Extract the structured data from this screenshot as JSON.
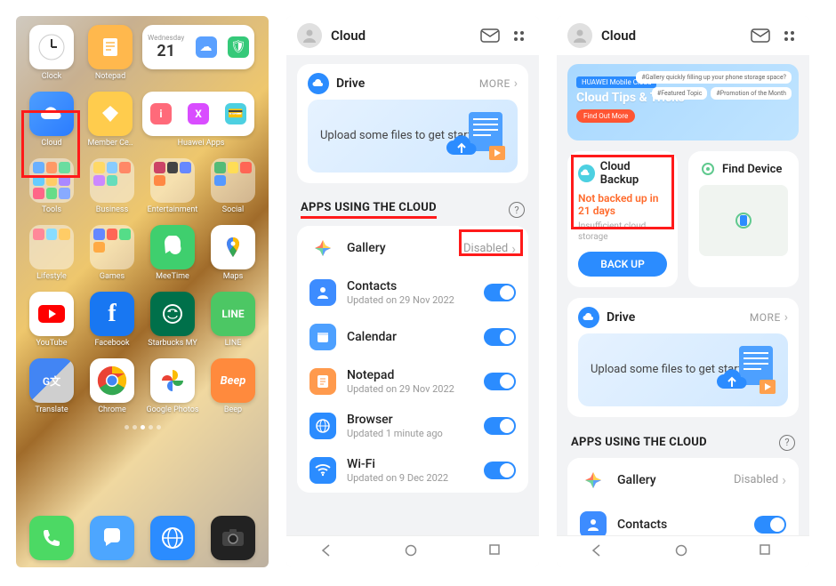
{
  "home": {
    "row1": {
      "clock": "Clock",
      "notepad": "Notepad",
      "cal_day": "21",
      "cal_dow": "Wednesday"
    },
    "row2": {
      "cloud": "Cloud",
      "member": "Member Ce..",
      "huawei_apps": "Huawei Apps"
    },
    "row3": {
      "tools": "Tools",
      "business": "Business",
      "entertainment": "Entertainment",
      "social": "Social"
    },
    "row4": {
      "lifestyle": "Lifestyle",
      "games": "Games",
      "meetime": "MeeTime",
      "maps": "Maps"
    },
    "row5": {
      "youtube": "YouTube",
      "facebook": "Facebook",
      "starbucks": "Starbucks MY",
      "line": "LINE"
    },
    "row6": {
      "translate": "Translate",
      "chrome": "Chrome",
      "gphotos": "Google Photos",
      "beep": "Beep"
    }
  },
  "cloud2": {
    "title": "Cloud",
    "drive": {
      "label": "Drive",
      "more": "MORE",
      "banner": "Upload some files to get started"
    },
    "section": "APPS USING THE CLOUD",
    "rows": {
      "gallery": {
        "title": "Gallery",
        "trail": "Disabled"
      },
      "contacts": {
        "title": "Contacts",
        "sub": "Updated on 29 Nov 2022"
      },
      "calendar": {
        "title": "Calendar"
      },
      "notepad": {
        "title": "Notepad",
        "sub": "Updated on 29 Nov 2022"
      },
      "browser": {
        "title": "Browser",
        "sub": "Updated 1 minute ago"
      },
      "wifi": {
        "title": "Wi-Fi",
        "sub": "Updated on 9 Dec 2022"
      }
    }
  },
  "cloud3": {
    "title": "Cloud",
    "promo": {
      "tag": "HUAWEI Mobile Cloud",
      "title": "Cloud Tips & Tricks",
      "pill1": "#Gallery quickly filling up your phone storage space?",
      "pill2": "#Featured Topic",
      "pill3": "#Promotion of the Month",
      "btn": "Find Out More"
    },
    "backup": {
      "title": "Cloud Backup",
      "warn": "Not backed up in 21 days",
      "sub": "Insufficient cloud storage",
      "btn": "BACK UP"
    },
    "find": {
      "title": "Find Device"
    },
    "drive": {
      "label": "Drive",
      "more": "MORE",
      "banner": "Upload some files to get started"
    },
    "section": "APPS USING THE CLOUD",
    "rows": {
      "gallery": {
        "title": "Gallery",
        "trail": "Disabled"
      },
      "contacts": {
        "title": "Contacts"
      }
    }
  }
}
